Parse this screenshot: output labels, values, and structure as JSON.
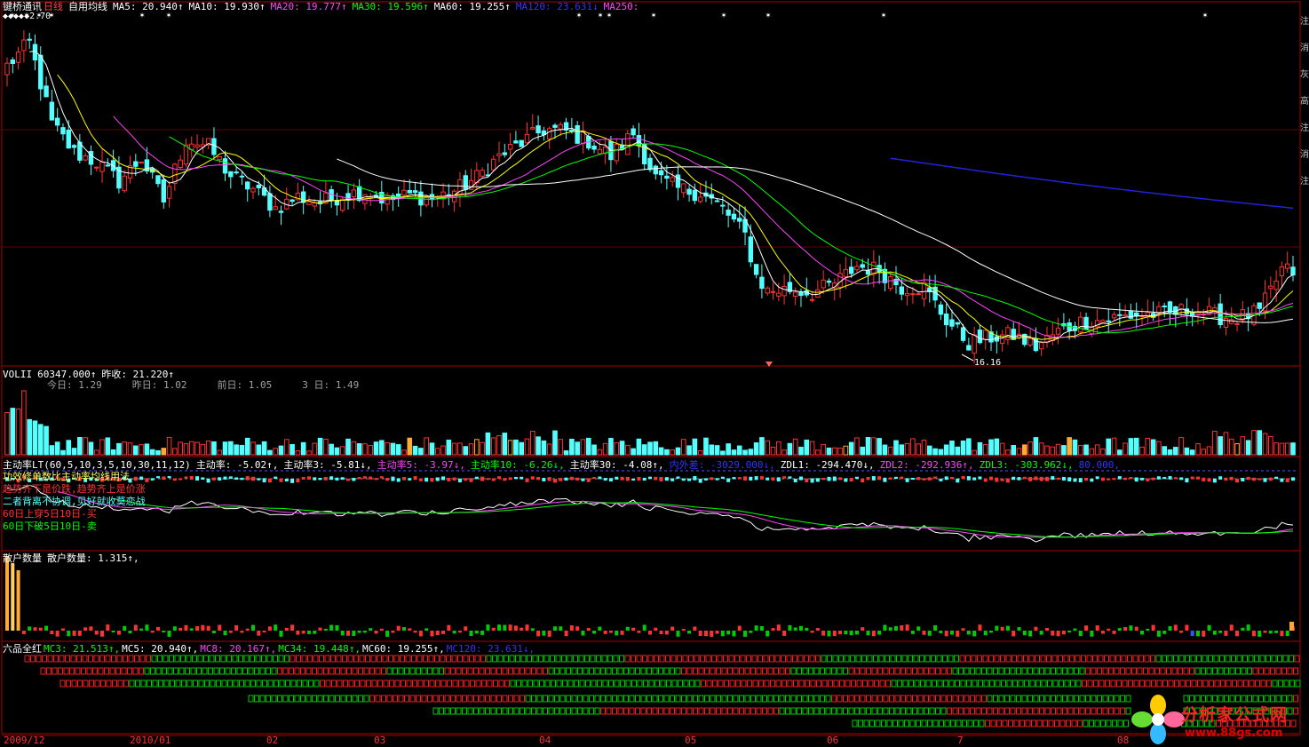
{
  "colors": {
    "bg": "#000000",
    "up": "#ff3232",
    "down": "#54ffff",
    "frame": "#aa0000",
    "ma5": "#ffffff",
    "ma10": "#ffff00",
    "ma20": "#ff44ff",
    "ma30": "#00ff00",
    "ma60": "#ffffff",
    "ma120": "#2222dd",
    "green_cell": "#00cc00",
    "red_cell": "#ee2222"
  },
  "header": {
    "stock": "键桥通讯",
    "period": "日线",
    "indicator": "自用均线",
    "ma5": "MA5: 20.940↑",
    "ma10": "MA10: 19.930↑",
    "ma20": "MA20: 19.777↑",
    "ma30": "MA30: 19.596↑",
    "ma60": "MA60: 19.255↑",
    "ma120": "MA120: 23.631↓",
    "ma250": "MA250:"
  },
  "top_marker": "◆◆◆◆◆2.70",
  "low_marker": "16.16",
  "vol_panel": {
    "title": "VOLII",
    "value": "60347.000↑",
    "prev_label": "昨收: 21.220↑",
    "today": "今日: 1.29",
    "yesterday": "昨日: 1.02",
    "before": "前日: 1.05",
    "three": "3 日: 1.49"
  },
  "zdl_panel": {
    "title": "主动率LT(60,5,10,3,5,10,30,11,12)",
    "items": [
      "主动率: -5.02↑,",
      "主动率3: -5.81↓,",
      "主动率5: -3.97↓,",
      "主动率10: -6.26↓,",
      "主动率30: -4.08↑,",
      "内外差: -3029.000↓,",
      "ZDL1: -294.470↓,",
      "ZDL2: -292.936↑,",
      "ZDL3: -303.962↓,",
      "80.000,"
    ],
    "notes": [
      "功效修单数比主动率均线用法",
      "趋势齐下是价跌,趋势齐上是价涨",
      "二者背离不协调,见好就收莫恋战",
      "60日上穿5日10日-买",
      "60日下破5日10日-卖"
    ]
  },
  "sh_panel": {
    "title": "散户数量",
    "value": "散户数量: 1.315↑,"
  },
  "lp_panel": {
    "title": "六品全红",
    "items": [
      "MC3: 21.513↑,",
      "MC5: 20.940↑,",
      "MC8: 20.167↑,",
      "MC34: 19.448↑,",
      "MC60: 19.255↑,",
      "MC120: 23.631↓,"
    ]
  },
  "side_labels": [
    "注",
    "消",
    "灰",
    "高",
    "注",
    "消",
    "注"
  ],
  "x_axis": [
    "2009/12",
    "2010/01",
    "02",
    "03",
    "04",
    "05",
    "06",
    "7",
    "08"
  ],
  "logo": {
    "text": "分析家公式网",
    "url": "www.88gs.com"
  },
  "chart_data": {
    "type": "candlestick",
    "title": "键桥通讯 日线",
    "x_axis_labels": [
      "2009/12",
      "2010/01",
      "02",
      "03",
      "04",
      "05",
      "06",
      "7",
      "08"
    ],
    "ylim": [
      15.5,
      33.5
    ],
    "high_label": 32.7,
    "low_label": 16.16,
    "close_anchors": [
      [
        0,
        31.0
      ],
      [
        4,
        32.2
      ],
      [
        8,
        28.0
      ],
      [
        12,
        26.5
      ],
      [
        16,
        26.0
      ],
      [
        20,
        25.0
      ],
      [
        24,
        26.2
      ],
      [
        28,
        24.0
      ],
      [
        32,
        27.2
      ],
      [
        36,
        26.8
      ],
      [
        40,
        25.3
      ],
      [
        44,
        24.6
      ],
      [
        48,
        23.6
      ],
      [
        52,
        24.2
      ],
      [
        56,
        23.9
      ],
      [
        60,
        24.3
      ],
      [
        64,
        24.5
      ],
      [
        68,
        24.0
      ],
      [
        72,
        24.3
      ],
      [
        76,
        24.1
      ],
      [
        80,
        24.5
      ],
      [
        84,
        25.2
      ],
      [
        88,
        26.3
      ],
      [
        92,
        27.0
      ],
      [
        96,
        27.7
      ],
      [
        100,
        27.6
      ],
      [
        104,
        27.1
      ],
      [
        108,
        26.3
      ],
      [
        112,
        27.5
      ],
      [
        116,
        25.2
      ],
      [
        120,
        24.6
      ],
      [
        124,
        24.4
      ],
      [
        128,
        23.6
      ],
      [
        132,
        22.2
      ],
      [
        134,
        20.1
      ],
      [
        136,
        19.3
      ],
      [
        140,
        19.4
      ],
      [
        144,
        19.2
      ],
      [
        148,
        19.7
      ],
      [
        152,
        20.6
      ],
      [
        156,
        20.4
      ],
      [
        160,
        19.5
      ],
      [
        164,
        19.5
      ],
      [
        168,
        17.8
      ],
      [
        172,
        16.6
      ],
      [
        176,
        16.9
      ],
      [
        180,
        17.0
      ],
      [
        184,
        16.4
      ],
      [
        188,
        17.2
      ],
      [
        192,
        17.7
      ],
      [
        196,
        17.8
      ],
      [
        200,
        18.0
      ],
      [
        204,
        18.1
      ],
      [
        208,
        18.1
      ],
      [
        212,
        18.4
      ],
      [
        216,
        18.0
      ],
      [
        220,
        17.9
      ],
      [
        224,
        18.2
      ],
      [
        228,
        20.4
      ]
    ],
    "ma_series": [
      {
        "name": "MA5",
        "value": 20.94,
        "color": "#ffffff"
      },
      {
        "name": "MA10",
        "value": 19.93,
        "color": "#ffff00"
      },
      {
        "name": "MA20",
        "value": 19.777,
        "color": "#ff44ff"
      },
      {
        "name": "MA30",
        "value": 19.596,
        "color": "#00ff00"
      },
      {
        "name": "MA60",
        "value": 19.255,
        "color": "#ffffff"
      },
      {
        "name": "MA120",
        "value": 23.631,
        "color": "#2222dd"
      }
    ]
  }
}
